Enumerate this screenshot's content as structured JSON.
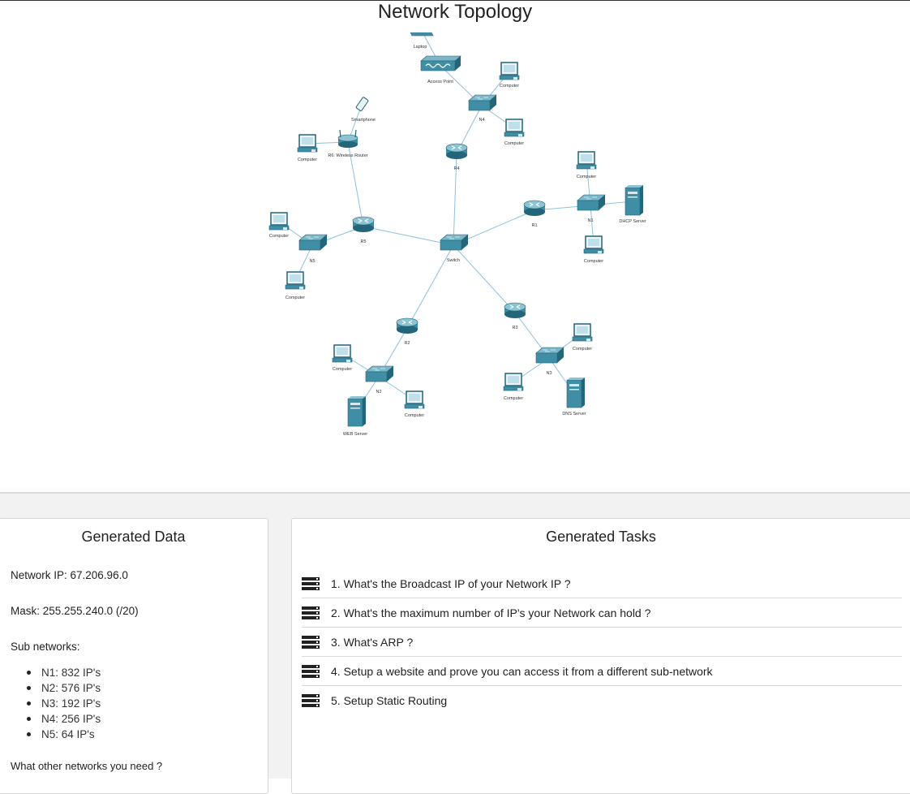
{
  "page": {
    "title": "Network Topology"
  },
  "topology": {
    "nodes": [
      {
        "id": "laptop",
        "type": "laptop",
        "label": "Laptop"
      },
      {
        "id": "ap",
        "type": "access-point",
        "label": "Access Point"
      },
      {
        "id": "n4pc1",
        "type": "computer",
        "label": "Computer"
      },
      {
        "id": "n4",
        "type": "switch",
        "label": "N4"
      },
      {
        "id": "n4pc2",
        "type": "computer",
        "label": "Computer"
      },
      {
        "id": "r4",
        "type": "router",
        "label": "R4"
      },
      {
        "id": "phone",
        "type": "smartphone",
        "label": "Smartphone"
      },
      {
        "id": "r6",
        "type": "wireless-router",
        "label": "R6: Wireless Router"
      },
      {
        "id": "r6pc",
        "type": "computer",
        "label": "Computer"
      },
      {
        "id": "n1pc1",
        "type": "computer",
        "label": "Computer"
      },
      {
        "id": "r1",
        "type": "router",
        "label": "R1"
      },
      {
        "id": "n1",
        "type": "switch",
        "label": "N1"
      },
      {
        "id": "dhcp",
        "type": "server",
        "label": "DHCP Server"
      },
      {
        "id": "n1pc2",
        "type": "computer",
        "label": "Computer"
      },
      {
        "id": "n5pc1",
        "type": "computer",
        "label": "Computer"
      },
      {
        "id": "n5",
        "type": "switch",
        "label": "N5"
      },
      {
        "id": "r5",
        "type": "router",
        "label": "R5"
      },
      {
        "id": "n5pc2",
        "type": "computer",
        "label": "Computer"
      },
      {
        "id": "sw",
        "type": "switch",
        "label": "Switch"
      },
      {
        "id": "r2",
        "type": "router",
        "label": "R2"
      },
      {
        "id": "r3",
        "type": "router",
        "label": "R3"
      },
      {
        "id": "n2pc1",
        "type": "computer",
        "label": "Computer"
      },
      {
        "id": "n2",
        "type": "switch",
        "label": "N2"
      },
      {
        "id": "n2pc2",
        "type": "computer",
        "label": "Computer"
      },
      {
        "id": "web",
        "type": "server",
        "label": "WEB Server"
      },
      {
        "id": "n3pc1",
        "type": "computer",
        "label": "Computer"
      },
      {
        "id": "n3",
        "type": "switch",
        "label": "N3"
      },
      {
        "id": "n3pc2",
        "type": "computer",
        "label": "Computer"
      },
      {
        "id": "dns",
        "type": "server",
        "label": "DNS Server"
      }
    ],
    "links": [
      [
        "laptop",
        "ap"
      ],
      [
        "ap",
        "n4"
      ],
      [
        "n4pc1",
        "n4"
      ],
      [
        "n4",
        "n4pc2"
      ],
      [
        "n4",
        "r4"
      ],
      [
        "r4",
        "sw"
      ],
      [
        "phone",
        "r6"
      ],
      [
        "r6pc",
        "r6"
      ],
      [
        "r6",
        "r5"
      ],
      [
        "r5",
        "sw"
      ],
      [
        "n5",
        "r5"
      ],
      [
        "n5pc1",
        "n5"
      ],
      [
        "n5",
        "n5pc2"
      ],
      [
        "sw",
        "r1"
      ],
      [
        "r1",
        "n1"
      ],
      [
        "n1pc1",
        "n1"
      ],
      [
        "n1",
        "dhcp"
      ],
      [
        "n1",
        "n1pc2"
      ],
      [
        "sw",
        "r2"
      ],
      [
        "r2",
        "n2"
      ],
      [
        "n2pc1",
        "n2"
      ],
      [
        "n2",
        "n2pc2"
      ],
      [
        "n2",
        "web"
      ],
      [
        "sw",
        "r3"
      ],
      [
        "r3",
        "n3"
      ],
      [
        "n3pc1",
        "n3"
      ],
      [
        "n3",
        "n3pc2"
      ],
      [
        "n3",
        "dns"
      ]
    ]
  },
  "data_panel": {
    "title": "Generated Data",
    "network_ip": "Network IP: 67.206.96.0",
    "mask": "Mask: 255.255.240.0 (/20)",
    "subnets_label": "Sub networks:",
    "subnets": [
      "N1: 832 IP's",
      "N2: 576 IP's",
      "N3: 192 IP's",
      "N4: 256 IP's",
      "N5: 64 IP's"
    ],
    "question": "What other networks you need ?"
  },
  "tasks_panel": {
    "title": "Generated Tasks",
    "icon": "server-icon",
    "tasks": [
      "1. What's the Broadcast IP of your Network IP ?",
      "2. What's the maximum number of IP's your Network can hold ?",
      "3. What's ARP ?",
      "4. Setup a website and prove you can access it from a different sub-network",
      "5. Setup Static Routing"
    ]
  },
  "colors": {
    "device_teal": "#3f8ea5",
    "device_dark": "#236579",
    "link": "#8fc0df",
    "panel_bg": "#f2f2f2"
  }
}
